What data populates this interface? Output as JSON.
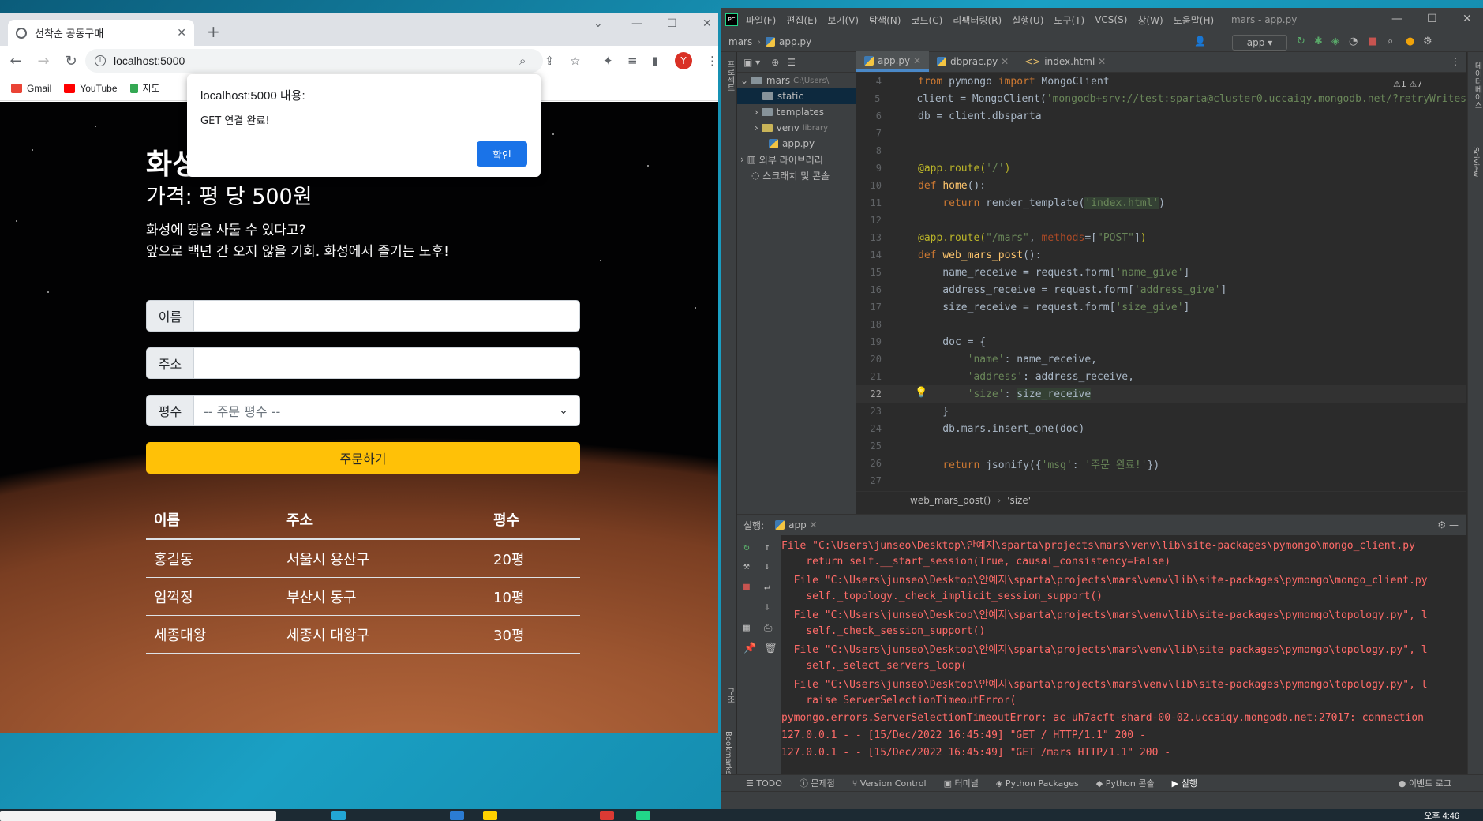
{
  "browser": {
    "tab_title": "선착순 공동구매",
    "url": "localhost:5000",
    "bookmarks": [
      "Gmail",
      "YouTube",
      "지도"
    ],
    "avatar_letter": "Y"
  },
  "alert": {
    "title": "localhost:5000 내용:",
    "message": "GET 연결 완료!",
    "ok": "확인"
  },
  "site": {
    "heading": "화성 땅 공동구매",
    "price": "가격: 평 당 500원",
    "desc1": "화성에 땅을 사둘 수 있다고?",
    "desc2": "앞으로 백년 간 오지 않을 기회. 화성에서 즐기는 노후!",
    "name_label": "이름",
    "address_label": "주소",
    "size_label": "평수",
    "size_placeholder": "-- 주문 평수 --",
    "order_button": "주문하기",
    "table_headers": [
      "이름",
      "주소",
      "평수"
    ],
    "rows": [
      [
        "홍길동",
        "서울시 용산구",
        "20평"
      ],
      [
        "임꺽정",
        "부산시 동구",
        "10평"
      ],
      [
        "세종대왕",
        "세종시 대왕구",
        "30평"
      ]
    ]
  },
  "ide": {
    "menus": [
      "파일(F)",
      "편집(E)",
      "보기(V)",
      "탐색(N)",
      "코드(C)",
      "리팩터링(R)",
      "실행(U)",
      "도구(T)",
      "VCS(S)",
      "창(W)",
      "도움말(H)"
    ],
    "title": "mars - app.py",
    "nav_project": "mars",
    "nav_file": "app.py",
    "run_config": "app",
    "project_tree": [
      {
        "label": "mars",
        "extra": "C:\\Users\\",
        "type": "folder"
      },
      {
        "label": "static",
        "extra": "",
        "type": "folder"
      },
      {
        "label": "templates",
        "extra": "",
        "type": "folder"
      },
      {
        "label": "venv",
        "extra": "library",
        "type": "folder"
      },
      {
        "label": "app.py",
        "extra": "",
        "type": "py"
      },
      {
        "label": "외부 라이브러리",
        "extra": "",
        "type": "lib"
      },
      {
        "label": "스크래치 및 콘솔",
        "extra": "",
        "type": "scratch"
      }
    ],
    "editor_tabs": [
      "app.py",
      "dbprac.py",
      "index.html"
    ],
    "inspection": "⚠1 ⚠7",
    "breadcrumb": [
      "web_mars_post()",
      "'size'"
    ],
    "run_label": "실행:",
    "run_tab": "app",
    "console_lines": [
      "File \"C:\\Users\\junseo\\Desktop\\안예지\\sparta\\projects\\mars\\venv\\lib\\site-packages\\pymongo\\mongo_client.py",
      "    return self.__start_session(True, causal_consistency=False)",
      "  File \"C:\\Users\\junseo\\Desktop\\안예지\\sparta\\projects\\mars\\venv\\lib\\site-packages\\pymongo\\mongo_client.py",
      "    self._topology._check_implicit_session_support()",
      "  File \"C:\\Users\\junseo\\Desktop\\안예지\\sparta\\projects\\mars\\venv\\lib\\site-packages\\pymongo\\topology.py\", l",
      "    self._check_session_support()",
      "  File \"C:\\Users\\junseo\\Desktop\\안예지\\sparta\\projects\\mars\\venv\\lib\\site-packages\\pymongo\\topology.py\", l",
      "    self._select_servers_loop(",
      "  File \"C:\\Users\\junseo\\Desktop\\안예지\\sparta\\projects\\mars\\venv\\lib\\site-packages\\pymongo\\topology.py\", l",
      "    raise ServerSelectionTimeoutError(",
      "pymongo.errors.ServerSelectionTimeoutError: ac-uh7acft-shard-00-02.uccaiqy.mongodb.net:27017: connection",
      "127.0.0.1 - - [15/Dec/2022 16:45:49] \"GET / HTTP/1.1\" 200 -",
      "127.0.0.1 - - [15/Dec/2022 16:45:49] \"GET /mars HTTP/1.1\" 200 -"
    ],
    "tool_windows": [
      "TODO",
      "문제점",
      "Version Control",
      "터미널",
      "Python Packages",
      "Python 콘솔",
      "실행",
      "이벤트 로그"
    ],
    "left_strip": [
      "프로젝트",
      "구조",
      "Bookmarks"
    ],
    "right_strip": [
      "데이터베이스",
      "SciView"
    ]
  },
  "clock": "오후 4:46"
}
